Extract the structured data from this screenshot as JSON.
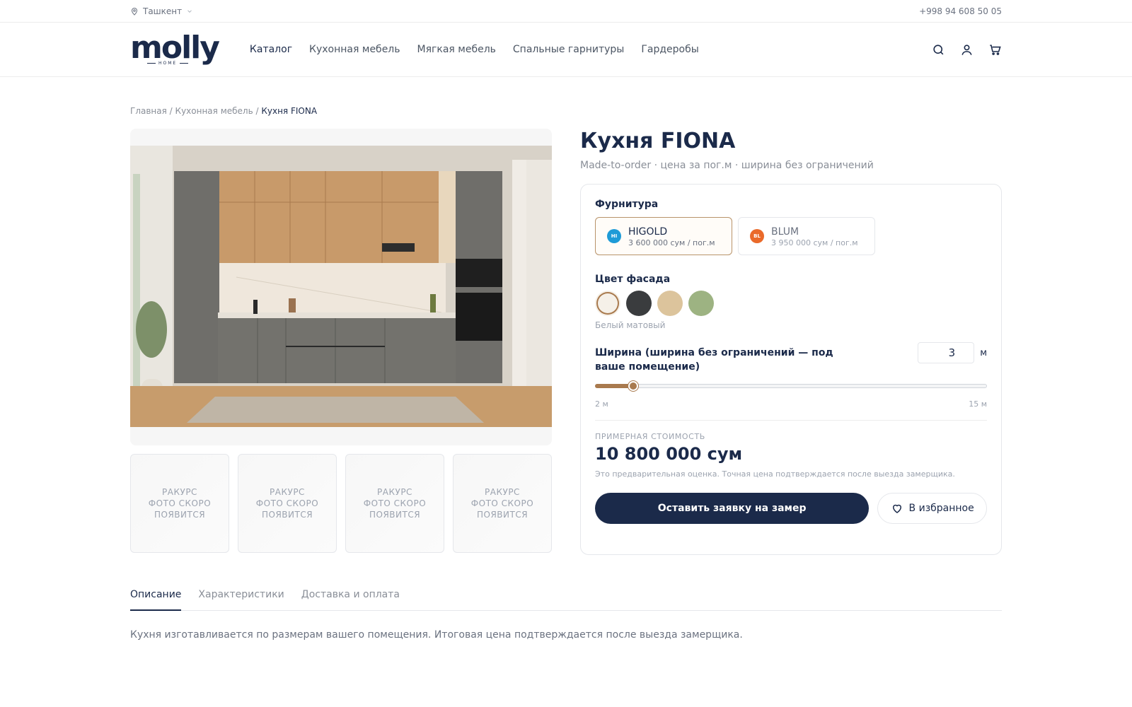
{
  "topbar": {
    "city": "Ташкент",
    "phone": "+998 94 608 50 05"
  },
  "header": {
    "logo": "molly",
    "logo_sub": "HOME",
    "nav": [
      "Каталог",
      "Кухонная мебель",
      "Мягкая мебель",
      "Спальные гарнитуры",
      "Гардеробы"
    ],
    "icons": [
      "search-icon",
      "user-icon",
      "cart-icon"
    ]
  },
  "breadcrumb": {
    "home": "Главная",
    "sep": "/",
    "category": "Кухонная мебель",
    "current": "Кухня FIONA"
  },
  "gallery": {
    "thumbs": [
      {
        "line1": "РАКУРС",
        "line2": "ФОТО СКОРО",
        "line3": "ПОЯВИТСЯ"
      },
      {
        "line1": "РАКУРС",
        "line2": "ФОТО СКОРО",
        "line3": "ПОЯВИТСЯ"
      },
      {
        "line1": "РАКУРС",
        "line2": "ФОТО СКОРО",
        "line3": "ПОЯВИТСЯ"
      },
      {
        "line1": "РАКУРС",
        "line2": "ФОТО СКОРО",
        "line3": "ПОЯВИТСЯ"
      }
    ]
  },
  "product": {
    "title": "Кухня FIONA",
    "subtitle": "Made-to-order · цена за пог.м · ширина без ограничений"
  },
  "config": {
    "hardware_label": "Фурнитура",
    "hardware": [
      {
        "badge": "HI",
        "name": "HIGOLD",
        "price": "3 600 000 сум / пог.м",
        "color": "#1e9bd7",
        "selected": true
      },
      {
        "badge": "BL",
        "name": "BLUM",
        "price": "3 950 000 сум / пог.м",
        "color": "#ea6a2a",
        "selected": false
      }
    ],
    "color_label": "Цвет фасада",
    "colors": [
      "#f5f0e8",
      "#3a3c3e",
      "#dcc49c",
      "#9db382"
    ],
    "selected_color_index": 0,
    "selected_color_name": "Белый матовый",
    "width_label": "Ширина (ширина без ограничений — под ваше помещение)",
    "width_value": "3",
    "width_unit": "м",
    "width_min": 2,
    "width_max": 15,
    "width_current": 3,
    "min_label": "2 м",
    "max_label": "15 м",
    "price_label": "ПРИМЕРНАЯ СТОИМОСТЬ",
    "price": "10 800 000 сум",
    "price_note": "Это предварительная оценка. Точная цена подтверждается после выезда замерщика.",
    "cta": "Оставить заявку на замер",
    "favorite": "В избранное",
    "accent": "#a97a4e",
    "primary": "#1b2a4a"
  },
  "tabs": [
    "Описание",
    "Характеристики",
    "Доставка и оплата"
  ],
  "active_tab": 0,
  "description": "Кухня изготавливается по размерам вашего помещения. Итоговая цена подтверждается после выезда замерщика."
}
